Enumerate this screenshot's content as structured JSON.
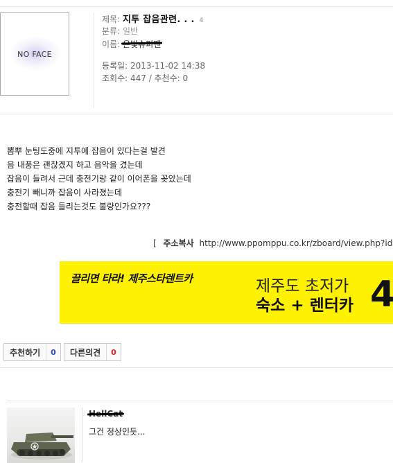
{
  "post": {
    "avatar_text": "NO FACE",
    "title_key": "제목:",
    "title_value": "지투 잡음관련. . .",
    "comment_count": "4",
    "category_key": "분류:",
    "category_value": "일반",
    "name_key": "이름:",
    "name_value": "은빛슈퍼맨",
    "date_label": "등록일: 2013-11-02 14:38",
    "stats_label": "조회수: 447 / 추천수: 0"
  },
  "body_lines": [
    "뽐뿌 눈팅도중에 지투에 잡음이 있다는걸 발견",
    "음 내풍은 괜찮겠지 하고 음악을 겼는데",
    "잡음이 들려서 근데 충전기랑 같이 이어폰을 꽂았는데",
    "충전기 빼니까 잡음이 사라졌는데",
    "충전할때 잡음 들리는것도 불량인가요???"
  ],
  "address": {
    "bracket": "[",
    "label": "주소복사",
    "url": "http://www.ppomppu.co.kr/zboard/view.php?id=p"
  },
  "banner": {
    "slogan": "끌리면 타라! 제주스타렌트카",
    "line1": "제주도 초저가",
    "line2": "숙소 + 렌터카",
    "big": "4"
  },
  "votes": {
    "recommend_label": "추천하기",
    "recommend_count": "0",
    "dissent_label": "다른의견",
    "dissent_count": "0"
  },
  "comment": {
    "author": "HellCat",
    "text": "그건 정상인듯..."
  },
  "colors": {
    "banner_bg": "#fff200",
    "recommend_count": "#2a4db8",
    "dissent_count": "#d4262b"
  }
}
